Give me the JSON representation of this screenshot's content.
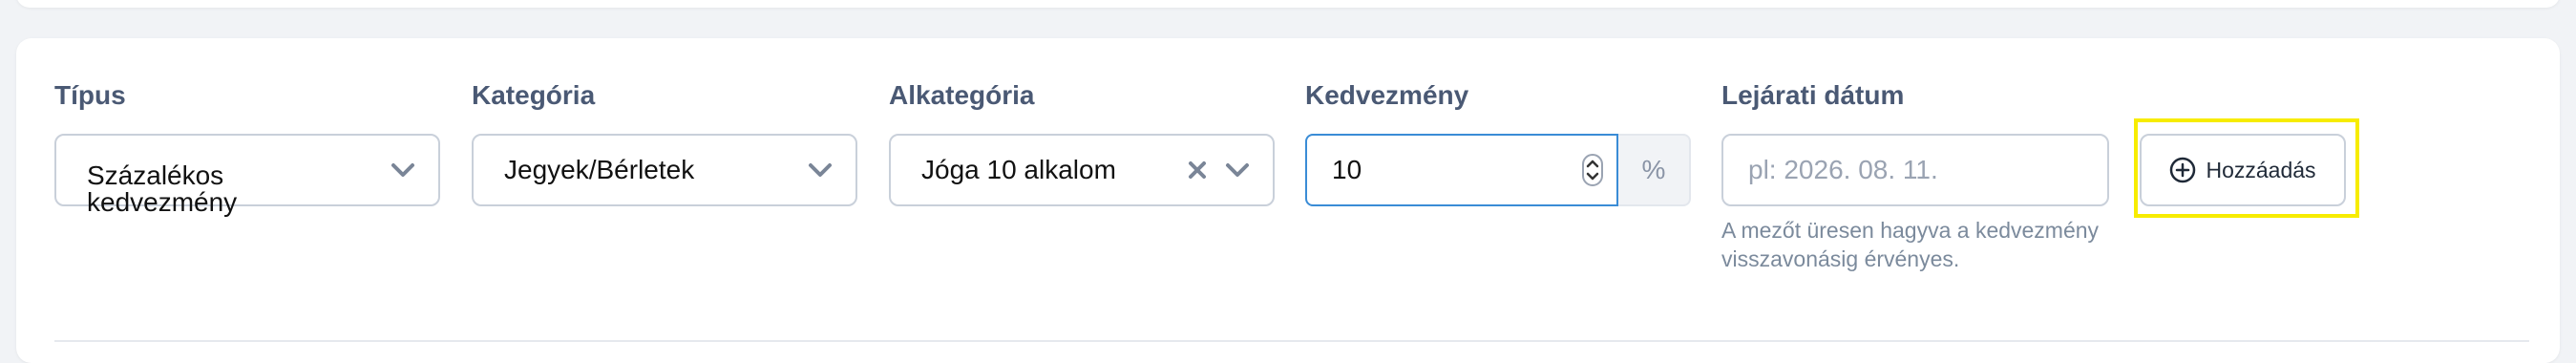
{
  "form": {
    "type": {
      "label": "Típus",
      "value": "Százalékos kedvezmény"
    },
    "category": {
      "label": "Kategória",
      "value": "Jegyek/Bérletek"
    },
    "subcategory": {
      "label": "Alkategória",
      "value": "Jóga 10 alkalom"
    },
    "discount": {
      "label": "Kedvezmény",
      "value": "10",
      "unit": "%"
    },
    "expiry": {
      "label": "Lejárati dátum",
      "placeholder": "pl: 2026. 08. 11.",
      "helper": "A mezőt üresen hagyva a kedvezmény visszavonásig érvényes."
    },
    "add_button": {
      "label": "Hozzáadás",
      "icon": "plus-circle-icon"
    }
  },
  "colors": {
    "focus_border": "#3a8cd6",
    "highlight": "#f7ec00",
    "label": "#4a5974"
  }
}
